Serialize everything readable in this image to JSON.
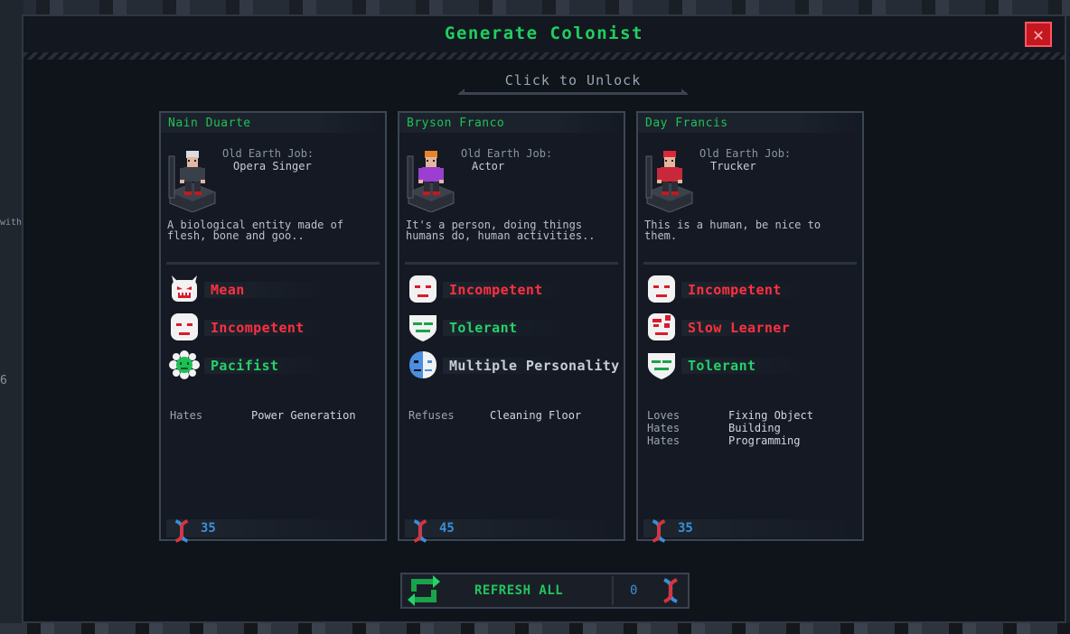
{
  "window": {
    "title": "Generate Colonist",
    "close_icon": "close-icon",
    "unlock_label": "Click to Unlock"
  },
  "background_fragments": [
    "with",
    "6"
  ],
  "colonists": [
    {
      "name": "Nain Duarte",
      "job_label": "Old Earth Job:",
      "job": "Opera Singer",
      "description": "A biological entity made of flesh, bone and goo..",
      "traits": [
        {
          "label": "Mean",
          "type": "negative",
          "icon": "devil-face-icon"
        },
        {
          "label": "Incompetent",
          "type": "negative",
          "icon": "incompetent-face-icon"
        },
        {
          "label": "Pacifist",
          "type": "positive",
          "icon": "flower-icon"
        }
      ],
      "preferences": [
        {
          "kind": "Hates",
          "value": "Power Generation"
        }
      ],
      "cost": "35",
      "suit_color": "#3a4049",
      "hair_color": "#d8dde2"
    },
    {
      "name": "Bryson Franco",
      "job_label": "Old Earth Job:",
      "job": "Actor",
      "description": "It's a person, doing things humans do, human activities..",
      "traits": [
        {
          "label": "Incompetent",
          "type": "negative",
          "icon": "incompetent-face-icon"
        },
        {
          "label": "Tolerant",
          "type": "positive",
          "icon": "tolerant-face-icon"
        },
        {
          "label": "Multiple Personality",
          "type": "neutral",
          "icon": "split-face-icon"
        }
      ],
      "preferences": [
        {
          "kind": "Refuses",
          "value": "Cleaning Floor"
        }
      ],
      "cost": "45",
      "suit_color": "#9a3fd0",
      "hair_color": "#e8842a"
    },
    {
      "name": "Day Francis",
      "job_label": "Old Earth Job:",
      "job": "Trucker",
      "description": "This is a human, be nice to them.",
      "traits": [
        {
          "label": "Incompetent",
          "type": "negative",
          "icon": "incompetent-face-icon"
        },
        {
          "label": "Slow Learner",
          "type": "negative",
          "icon": "slow-learner-face-icon"
        },
        {
          "label": "Tolerant",
          "type": "positive",
          "icon": "tolerant-face-icon"
        }
      ],
      "preferences": [
        {
          "kind": "Loves",
          "value": "Fixing Object"
        },
        {
          "kind": "Hates",
          "value": "Building"
        },
        {
          "kind": "Hates",
          "value": "Programming"
        }
      ],
      "cost": "35",
      "suit_color": "#c8283a",
      "hair_color": "#d8283a"
    }
  ],
  "refresh": {
    "label": "REFRESH ALL",
    "count": "0",
    "icon": "refresh-icon",
    "currency_icon": "dna-icon"
  },
  "colors": {
    "positive": "#25d168",
    "negative": "#ff3040",
    "neutral": "#c7cdd4",
    "accent_blue": "#3a8fd9",
    "title_green": "#1fd060"
  }
}
